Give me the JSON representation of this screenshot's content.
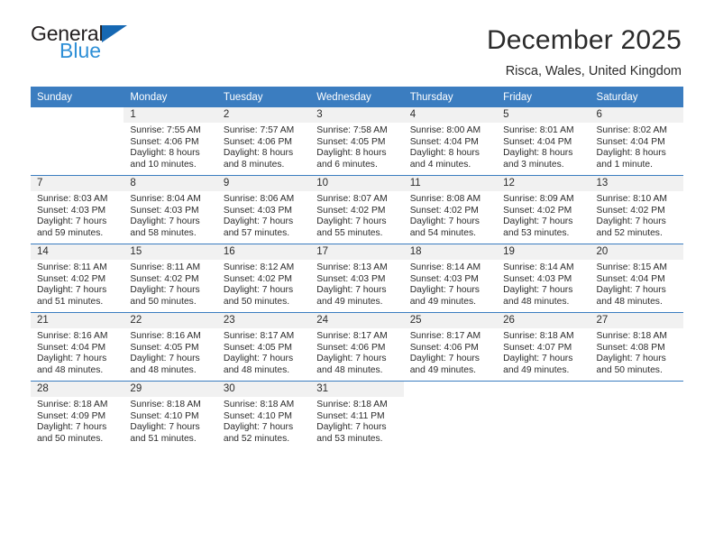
{
  "brand": {
    "line1": "General",
    "line2": "Blue",
    "triangle_color": "#1668b3",
    "line2_color": "#2e8fd6",
    "logo_icon": "general-blue-logo"
  },
  "header": {
    "month_title": "December 2025",
    "location": "Risca, Wales, United Kingdom"
  },
  "theme": {
    "header_blue": "#3b7dc0",
    "daynum_bg": "#f1f1f1",
    "text": "#2b2b2b"
  },
  "calendar": {
    "weekday_headers": [
      "Sunday",
      "Monday",
      "Tuesday",
      "Wednesday",
      "Thursday",
      "Friday",
      "Saturday"
    ],
    "weeks": [
      [
        {
          "day": "",
          "sunrise": "",
          "sunset": "",
          "daylight_l1": "",
          "daylight_l2": ""
        },
        {
          "day": "1",
          "sunrise": "Sunrise: 7:55 AM",
          "sunset": "Sunset: 4:06 PM",
          "daylight_l1": "Daylight: 8 hours",
          "daylight_l2": "and 10 minutes."
        },
        {
          "day": "2",
          "sunrise": "Sunrise: 7:57 AM",
          "sunset": "Sunset: 4:06 PM",
          "daylight_l1": "Daylight: 8 hours",
          "daylight_l2": "and 8 minutes."
        },
        {
          "day": "3",
          "sunrise": "Sunrise: 7:58 AM",
          "sunset": "Sunset: 4:05 PM",
          "daylight_l1": "Daylight: 8 hours",
          "daylight_l2": "and 6 minutes."
        },
        {
          "day": "4",
          "sunrise": "Sunrise: 8:00 AM",
          "sunset": "Sunset: 4:04 PM",
          "daylight_l1": "Daylight: 8 hours",
          "daylight_l2": "and 4 minutes."
        },
        {
          "day": "5",
          "sunrise": "Sunrise: 8:01 AM",
          "sunset": "Sunset: 4:04 PM",
          "daylight_l1": "Daylight: 8 hours",
          "daylight_l2": "and 3 minutes."
        },
        {
          "day": "6",
          "sunrise": "Sunrise: 8:02 AM",
          "sunset": "Sunset: 4:04 PM",
          "daylight_l1": "Daylight: 8 hours",
          "daylight_l2": "and 1 minute."
        }
      ],
      [
        {
          "day": "7",
          "sunrise": "Sunrise: 8:03 AM",
          "sunset": "Sunset: 4:03 PM",
          "daylight_l1": "Daylight: 7 hours",
          "daylight_l2": "and 59 minutes."
        },
        {
          "day": "8",
          "sunrise": "Sunrise: 8:04 AM",
          "sunset": "Sunset: 4:03 PM",
          "daylight_l1": "Daylight: 7 hours",
          "daylight_l2": "and 58 minutes."
        },
        {
          "day": "9",
          "sunrise": "Sunrise: 8:06 AM",
          "sunset": "Sunset: 4:03 PM",
          "daylight_l1": "Daylight: 7 hours",
          "daylight_l2": "and 57 minutes."
        },
        {
          "day": "10",
          "sunrise": "Sunrise: 8:07 AM",
          "sunset": "Sunset: 4:02 PM",
          "daylight_l1": "Daylight: 7 hours",
          "daylight_l2": "and 55 minutes."
        },
        {
          "day": "11",
          "sunrise": "Sunrise: 8:08 AM",
          "sunset": "Sunset: 4:02 PM",
          "daylight_l1": "Daylight: 7 hours",
          "daylight_l2": "and 54 minutes."
        },
        {
          "day": "12",
          "sunrise": "Sunrise: 8:09 AM",
          "sunset": "Sunset: 4:02 PM",
          "daylight_l1": "Daylight: 7 hours",
          "daylight_l2": "and 53 minutes."
        },
        {
          "day": "13",
          "sunrise": "Sunrise: 8:10 AM",
          "sunset": "Sunset: 4:02 PM",
          "daylight_l1": "Daylight: 7 hours",
          "daylight_l2": "and 52 minutes."
        }
      ],
      [
        {
          "day": "14",
          "sunrise": "Sunrise: 8:11 AM",
          "sunset": "Sunset: 4:02 PM",
          "daylight_l1": "Daylight: 7 hours",
          "daylight_l2": "and 51 minutes."
        },
        {
          "day": "15",
          "sunrise": "Sunrise: 8:11 AM",
          "sunset": "Sunset: 4:02 PM",
          "daylight_l1": "Daylight: 7 hours",
          "daylight_l2": "and 50 minutes."
        },
        {
          "day": "16",
          "sunrise": "Sunrise: 8:12 AM",
          "sunset": "Sunset: 4:02 PM",
          "daylight_l1": "Daylight: 7 hours",
          "daylight_l2": "and 50 minutes."
        },
        {
          "day": "17",
          "sunrise": "Sunrise: 8:13 AM",
          "sunset": "Sunset: 4:03 PM",
          "daylight_l1": "Daylight: 7 hours",
          "daylight_l2": "and 49 minutes."
        },
        {
          "day": "18",
          "sunrise": "Sunrise: 8:14 AM",
          "sunset": "Sunset: 4:03 PM",
          "daylight_l1": "Daylight: 7 hours",
          "daylight_l2": "and 49 minutes."
        },
        {
          "day": "19",
          "sunrise": "Sunrise: 8:14 AM",
          "sunset": "Sunset: 4:03 PM",
          "daylight_l1": "Daylight: 7 hours",
          "daylight_l2": "and 48 minutes."
        },
        {
          "day": "20",
          "sunrise": "Sunrise: 8:15 AM",
          "sunset": "Sunset: 4:04 PM",
          "daylight_l1": "Daylight: 7 hours",
          "daylight_l2": "and 48 minutes."
        }
      ],
      [
        {
          "day": "21",
          "sunrise": "Sunrise: 8:16 AM",
          "sunset": "Sunset: 4:04 PM",
          "daylight_l1": "Daylight: 7 hours",
          "daylight_l2": "and 48 minutes."
        },
        {
          "day": "22",
          "sunrise": "Sunrise: 8:16 AM",
          "sunset": "Sunset: 4:05 PM",
          "daylight_l1": "Daylight: 7 hours",
          "daylight_l2": "and 48 minutes."
        },
        {
          "day": "23",
          "sunrise": "Sunrise: 8:17 AM",
          "sunset": "Sunset: 4:05 PM",
          "daylight_l1": "Daylight: 7 hours",
          "daylight_l2": "and 48 minutes."
        },
        {
          "day": "24",
          "sunrise": "Sunrise: 8:17 AM",
          "sunset": "Sunset: 4:06 PM",
          "daylight_l1": "Daylight: 7 hours",
          "daylight_l2": "and 48 minutes."
        },
        {
          "day": "25",
          "sunrise": "Sunrise: 8:17 AM",
          "sunset": "Sunset: 4:06 PM",
          "daylight_l1": "Daylight: 7 hours",
          "daylight_l2": "and 49 minutes."
        },
        {
          "day": "26",
          "sunrise": "Sunrise: 8:18 AM",
          "sunset": "Sunset: 4:07 PM",
          "daylight_l1": "Daylight: 7 hours",
          "daylight_l2": "and 49 minutes."
        },
        {
          "day": "27",
          "sunrise": "Sunrise: 8:18 AM",
          "sunset": "Sunset: 4:08 PM",
          "daylight_l1": "Daylight: 7 hours",
          "daylight_l2": "and 50 minutes."
        }
      ],
      [
        {
          "day": "28",
          "sunrise": "Sunrise: 8:18 AM",
          "sunset": "Sunset: 4:09 PM",
          "daylight_l1": "Daylight: 7 hours",
          "daylight_l2": "and 50 minutes."
        },
        {
          "day": "29",
          "sunrise": "Sunrise: 8:18 AM",
          "sunset": "Sunset: 4:10 PM",
          "daylight_l1": "Daylight: 7 hours",
          "daylight_l2": "and 51 minutes."
        },
        {
          "day": "30",
          "sunrise": "Sunrise: 8:18 AM",
          "sunset": "Sunset: 4:10 PM",
          "daylight_l1": "Daylight: 7 hours",
          "daylight_l2": "and 52 minutes."
        },
        {
          "day": "31",
          "sunrise": "Sunrise: 8:18 AM",
          "sunset": "Sunset: 4:11 PM",
          "daylight_l1": "Daylight: 7 hours",
          "daylight_l2": "and 53 minutes."
        },
        {
          "day": "",
          "sunrise": "",
          "sunset": "",
          "daylight_l1": "",
          "daylight_l2": ""
        },
        {
          "day": "",
          "sunrise": "",
          "sunset": "",
          "daylight_l1": "",
          "daylight_l2": ""
        },
        {
          "day": "",
          "sunrise": "",
          "sunset": "",
          "daylight_l1": "",
          "daylight_l2": ""
        }
      ]
    ]
  }
}
